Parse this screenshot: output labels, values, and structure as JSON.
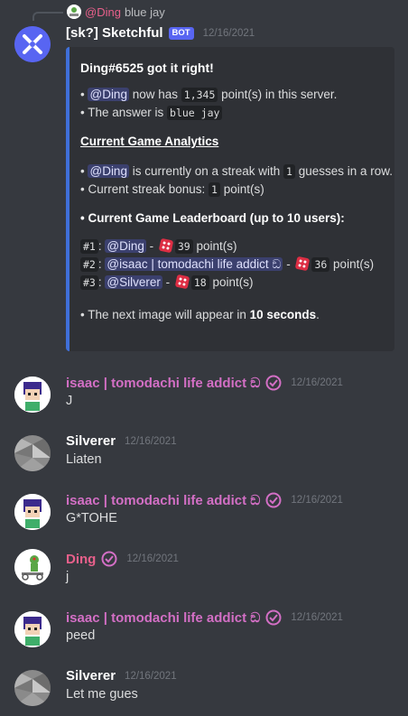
{
  "reply": {
    "mention": "@Ding",
    "text": "blue jay"
  },
  "bot_message": {
    "username": "[sk?] Sketchful",
    "badge": "BOT",
    "timestamp": "12/16/2021",
    "embed": {
      "title": "Ding#6525 got it right!",
      "line1_pre": "• ",
      "line1_mention": "@Ding",
      "line1_mid": " now has ",
      "line1_code": "1,345",
      "line1_post": " point(s) in this server.",
      "line2_pre": "• The answer is ",
      "line2_code": "blue jay",
      "section_title": "Current Game Analytics",
      "streak_pre": "• ",
      "streak_mention": "@Ding",
      "streak_mid": " is currently on a streak with ",
      "streak_code": "1",
      "streak_post": " guesses in a row.",
      "bonus_pre": "• Current streak bonus: ",
      "bonus_code": "1",
      "bonus_post": " point(s)",
      "leaderboard_title": "• Current Game Leaderboard (up to 10 users):",
      "leaderboard": [
        {
          "rank": "#1",
          "name": "@Ding",
          "points": "39",
          "suffix": " point(s)"
        },
        {
          "rank": "#2",
          "name": "@isaac | tomodachi life addict ඞ",
          "points": "36",
          "suffix": " point(s)"
        },
        {
          "rank": "#3",
          "name": "@Silverer",
          "points": "18",
          "suffix": " point(s)"
        }
      ],
      "next_pre": "• The next image will appear in ",
      "next_bold": "10 seconds",
      "next_post": "."
    }
  },
  "messages": [
    {
      "username": "isaac | tomodachi life addict ඞ",
      "timestamp": "12/16/2021",
      "text": "J",
      "color": "#d36fc5"
    },
    {
      "username": "Silverer",
      "timestamp": "12/16/2021",
      "text": "Liaten",
      "color": "#ffffff"
    },
    {
      "username": "isaac | tomodachi life addict ඞ",
      "timestamp": "12/16/2021",
      "text": "G*TOHE",
      "color": "#d36fc5"
    },
    {
      "username": "Ding",
      "timestamp": "12/16/2021",
      "text": "j",
      "color": "#e8608b"
    },
    {
      "username": "isaac | tomodachi life addict ඞ",
      "timestamp": "12/16/2021",
      "text": "peed",
      "color": "#d36fc5"
    },
    {
      "username": "Silverer",
      "timestamp": "12/16/2021",
      "text": "Let me gues",
      "color": "#ffffff"
    }
  ],
  "colors": {
    "background": "#36393f",
    "embed_bg": "#2f3136",
    "embed_accent": "#3f6fd8",
    "bot_avatar": "#5865f2",
    "verified": "#d36fc5"
  }
}
